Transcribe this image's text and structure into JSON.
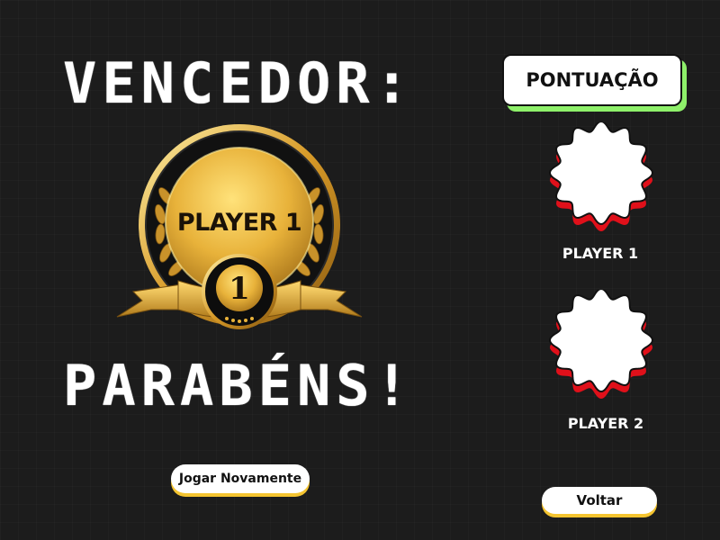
{
  "screen": {
    "winner_heading": "VENCEDOR:",
    "congrats_heading": "PARABÉNS!"
  },
  "medal": {
    "winner_name": "PLAYER 1",
    "rank_number": "1"
  },
  "buttons": {
    "play_again_label": "Jogar Novamente",
    "back_label": "Voltar"
  },
  "scoreboard": {
    "title": "PONTUAÇÃO",
    "players": [
      {
        "name": "PLAYER 1",
        "score": ""
      },
      {
        "name": "PLAYER 2",
        "score": ""
      }
    ]
  },
  "icons": {
    "medal": "gold-medal-icon",
    "badge": "wavy-badge-icon"
  },
  "colors": {
    "background": "#1c1c1c",
    "gold": "#e8b23a",
    "accent_green": "#8ef06a",
    "accent_red": "#e0101a",
    "button_shadow": "#f4c430"
  }
}
